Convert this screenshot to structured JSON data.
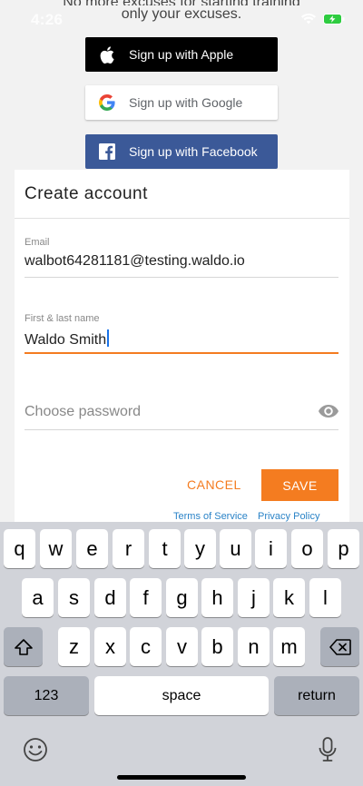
{
  "status": {
    "time": "4:26"
  },
  "tagline": {
    "line1": "No more excuses for starting training",
    "line2": "only your excuses."
  },
  "social": {
    "apple": "Sign up with Apple",
    "google": "Sign up with Google",
    "facebook": "Sign up with Facebook"
  },
  "form": {
    "title": "Create account",
    "email_label": "Email",
    "email_value": "walbot64281181@testing.waldo.io",
    "name_label": "First & last name",
    "name_value": "Waldo Smith",
    "password_placeholder": "Choose password",
    "cancel": "CANCEL",
    "save": "SAVE",
    "terms": "Terms of Service",
    "privacy": "Privacy Policy"
  },
  "keyboard": {
    "row1": [
      "q",
      "w",
      "e",
      "r",
      "t",
      "y",
      "u",
      "i",
      "o",
      "p"
    ],
    "row2": [
      "a",
      "s",
      "d",
      "f",
      "g",
      "h",
      "j",
      "k",
      "l"
    ],
    "row3": [
      "z",
      "x",
      "c",
      "v",
      "b",
      "n",
      "m"
    ],
    "numbers": "123",
    "space": "space",
    "return": "return"
  },
  "colors": {
    "accent": "#f47c20",
    "facebook": "#3b5998",
    "link": "#2a83c7"
  }
}
